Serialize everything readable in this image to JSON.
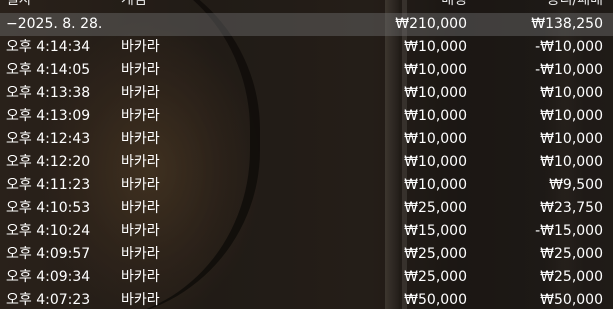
{
  "header": {
    "date": "일자",
    "game": "게임",
    "bet": "배팅",
    "result": "승리/패배"
  },
  "summary": {
    "date": "−2025. 8. 28.",
    "bet": "₩210,000",
    "result": "₩138,250"
  },
  "rows": [
    {
      "time": "오후 4:14:34",
      "game": "바카라",
      "bet": "₩10,000",
      "result": "-₩10,000"
    },
    {
      "time": "오후 4:14:05",
      "game": "바카라",
      "bet": "₩10,000",
      "result": "-₩10,000"
    },
    {
      "time": "오후 4:13:38",
      "game": "바카라",
      "bet": "₩10,000",
      "result": "₩10,000"
    },
    {
      "time": "오후 4:13:09",
      "game": "바카라",
      "bet": "₩10,000",
      "result": "₩10,000"
    },
    {
      "time": "오후 4:12:43",
      "game": "바카라",
      "bet": "₩10,000",
      "result": "₩10,000"
    },
    {
      "time": "오후 4:12:20",
      "game": "바카라",
      "bet": "₩10,000",
      "result": "₩10,000"
    },
    {
      "time": "오후 4:11:23",
      "game": "바카라",
      "bet": "₩10,000",
      "result": "₩9,500"
    },
    {
      "time": "오후 4:10:53",
      "game": "바카라",
      "bet": "₩25,000",
      "result": "₩23,750"
    },
    {
      "time": "오후 4:10:24",
      "game": "바카라",
      "bet": "₩15,000",
      "result": "-₩15,000"
    },
    {
      "time": "오후 4:09:57",
      "game": "바카라",
      "bet": "₩25,000",
      "result": "₩25,000"
    },
    {
      "time": "오후 4:09:34",
      "game": "바카라",
      "bet": "₩25,000",
      "result": "₩25,000"
    },
    {
      "time": "오후 4:07:23",
      "game": "바카라",
      "bet": "₩50,000",
      "result": "₩50,000"
    }
  ]
}
